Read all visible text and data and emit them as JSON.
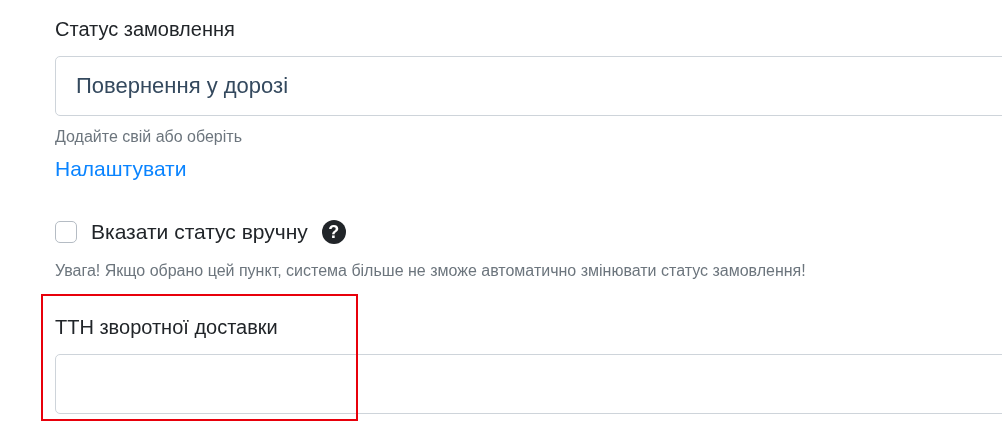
{
  "order_status": {
    "label": "Статус замовлення",
    "value": "Повернення у дорозі",
    "hint": "Додайте свій або оберіть",
    "link": "Налаштувати"
  },
  "manual_status": {
    "label": "Вказати статус вручну",
    "checked": false,
    "help_icon": "?",
    "warning": "Увага! Якщо обрано цей пункт, система більше не зможе автоматично змінювати статус замовлення!"
  },
  "return_ttn": {
    "label": "ТТН зворотної доставки",
    "highlighted": true
  }
}
